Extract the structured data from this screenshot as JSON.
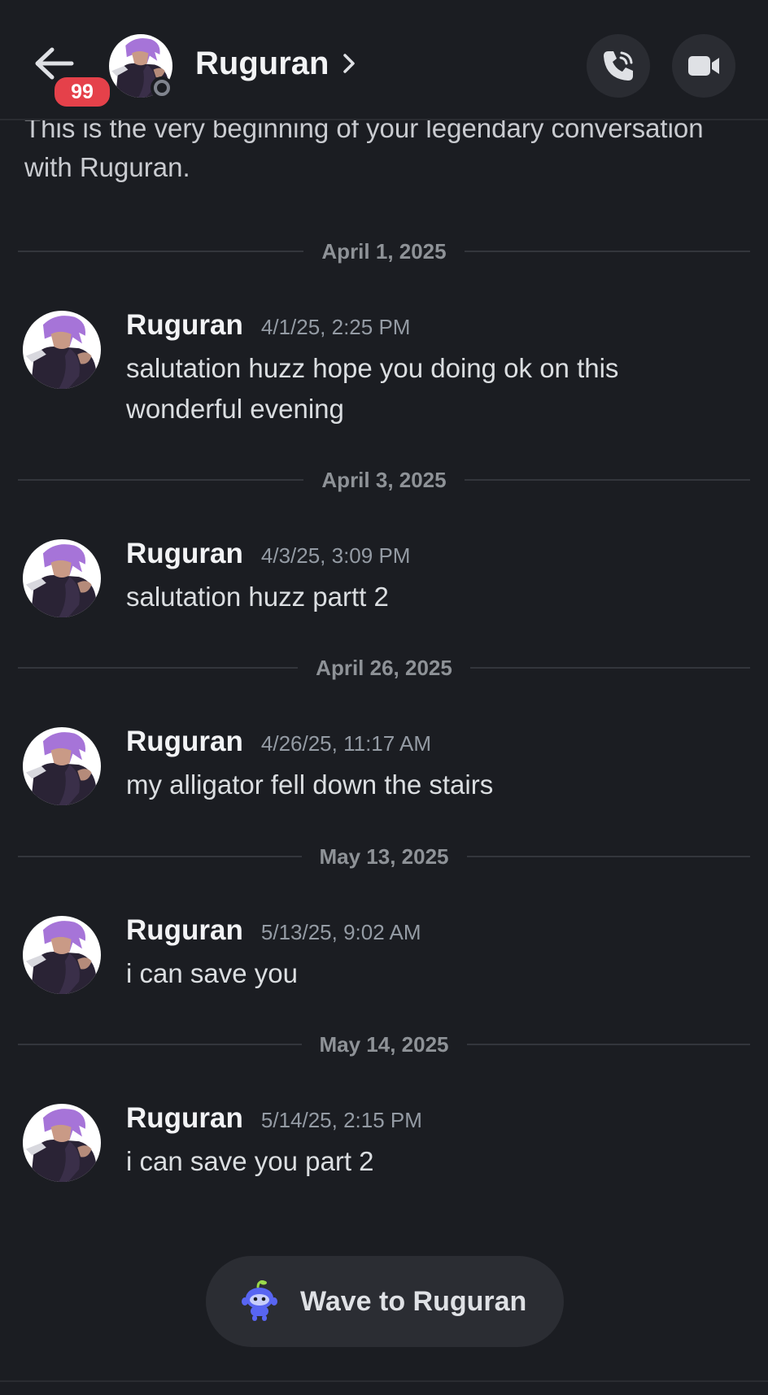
{
  "header": {
    "unread_count": "99",
    "title": "Ruguran",
    "avatar_icon": "user-avatar",
    "call_icon": "phone-call-icon",
    "video_icon": "video-camera-icon"
  },
  "intro": {
    "text": "This is the very beginning of your legendary conversation with Ruguran."
  },
  "dates": [
    "April 1, 2025",
    "April 3, 2025",
    "April 26, 2025",
    "May 13, 2025",
    "May 14, 2025"
  ],
  "messages": [
    {
      "author": "Ruguran",
      "time": "4/1/25, 2:25 PM",
      "text": "salutation huzz hope you doing ok on this wonderful evening"
    },
    {
      "author": "Ruguran",
      "time": "4/3/25, 3:09 PM",
      "text": "salutation huzz partt 2"
    },
    {
      "author": "Ruguran",
      "time": "4/26/25, 11:17 AM",
      "text": "my alligator fell down the stairs"
    },
    {
      "author": "Ruguran",
      "time": "5/13/25, 9:02 AM",
      "text": "i can save you"
    },
    {
      "author": "Ruguran",
      "time": "5/14/25, 2:15 PM",
      "text": "i can save you part 2"
    }
  ],
  "wave": {
    "label": "Wave to Ruguran",
    "icon": "wumpus-wave-icon"
  },
  "colors": {
    "background": "#1b1d22",
    "badge": "#e5414a",
    "avatar_hair": "#a674d8",
    "wumpus": "#5865f2"
  }
}
